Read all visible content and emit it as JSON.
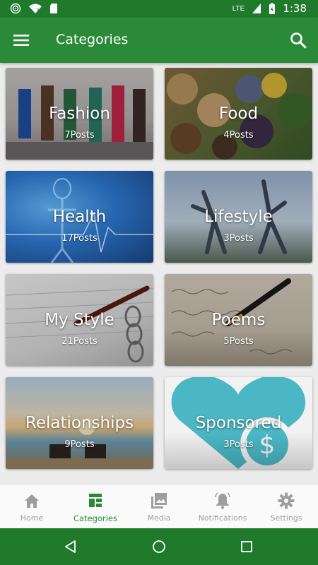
{
  "status": {
    "time": "1:38",
    "network": "LTE",
    "icons": [
      "location-icon",
      "wifi-icon",
      "sd-card-icon",
      "signal-icon",
      "battery-icon"
    ]
  },
  "appbar": {
    "title": "Categories",
    "menu_icon": "hamburger-menu-icon",
    "search_icon": "search-icon"
  },
  "categories": [
    {
      "name": "Fashion",
      "count": "7Posts"
    },
    {
      "name": "Food",
      "count": "4Posts"
    },
    {
      "name": "Health",
      "count": "17Posts"
    },
    {
      "name": "Lifestyle",
      "count": "3Posts"
    },
    {
      "name": "My Style",
      "count": "21Posts"
    },
    {
      "name": "Poems",
      "count": "5Posts"
    },
    {
      "name": "Relationships",
      "count": "9Posts"
    },
    {
      "name": "Sponsored",
      "count": "3Posts"
    }
  ],
  "bottom_nav": [
    {
      "label": "Home",
      "icon": "home-icon"
    },
    {
      "label": "Categories",
      "icon": "categories-icon",
      "active": true
    },
    {
      "label": "Media",
      "icon": "media-icon"
    },
    {
      "label": "Notifications",
      "icon": "bell-icon"
    },
    {
      "label": "Settings",
      "icon": "gear-icon"
    }
  ],
  "colors": {
    "primary": "#2a8a38",
    "primary_dark": "#1f7a2c",
    "inactive": "#9e9e9e"
  }
}
